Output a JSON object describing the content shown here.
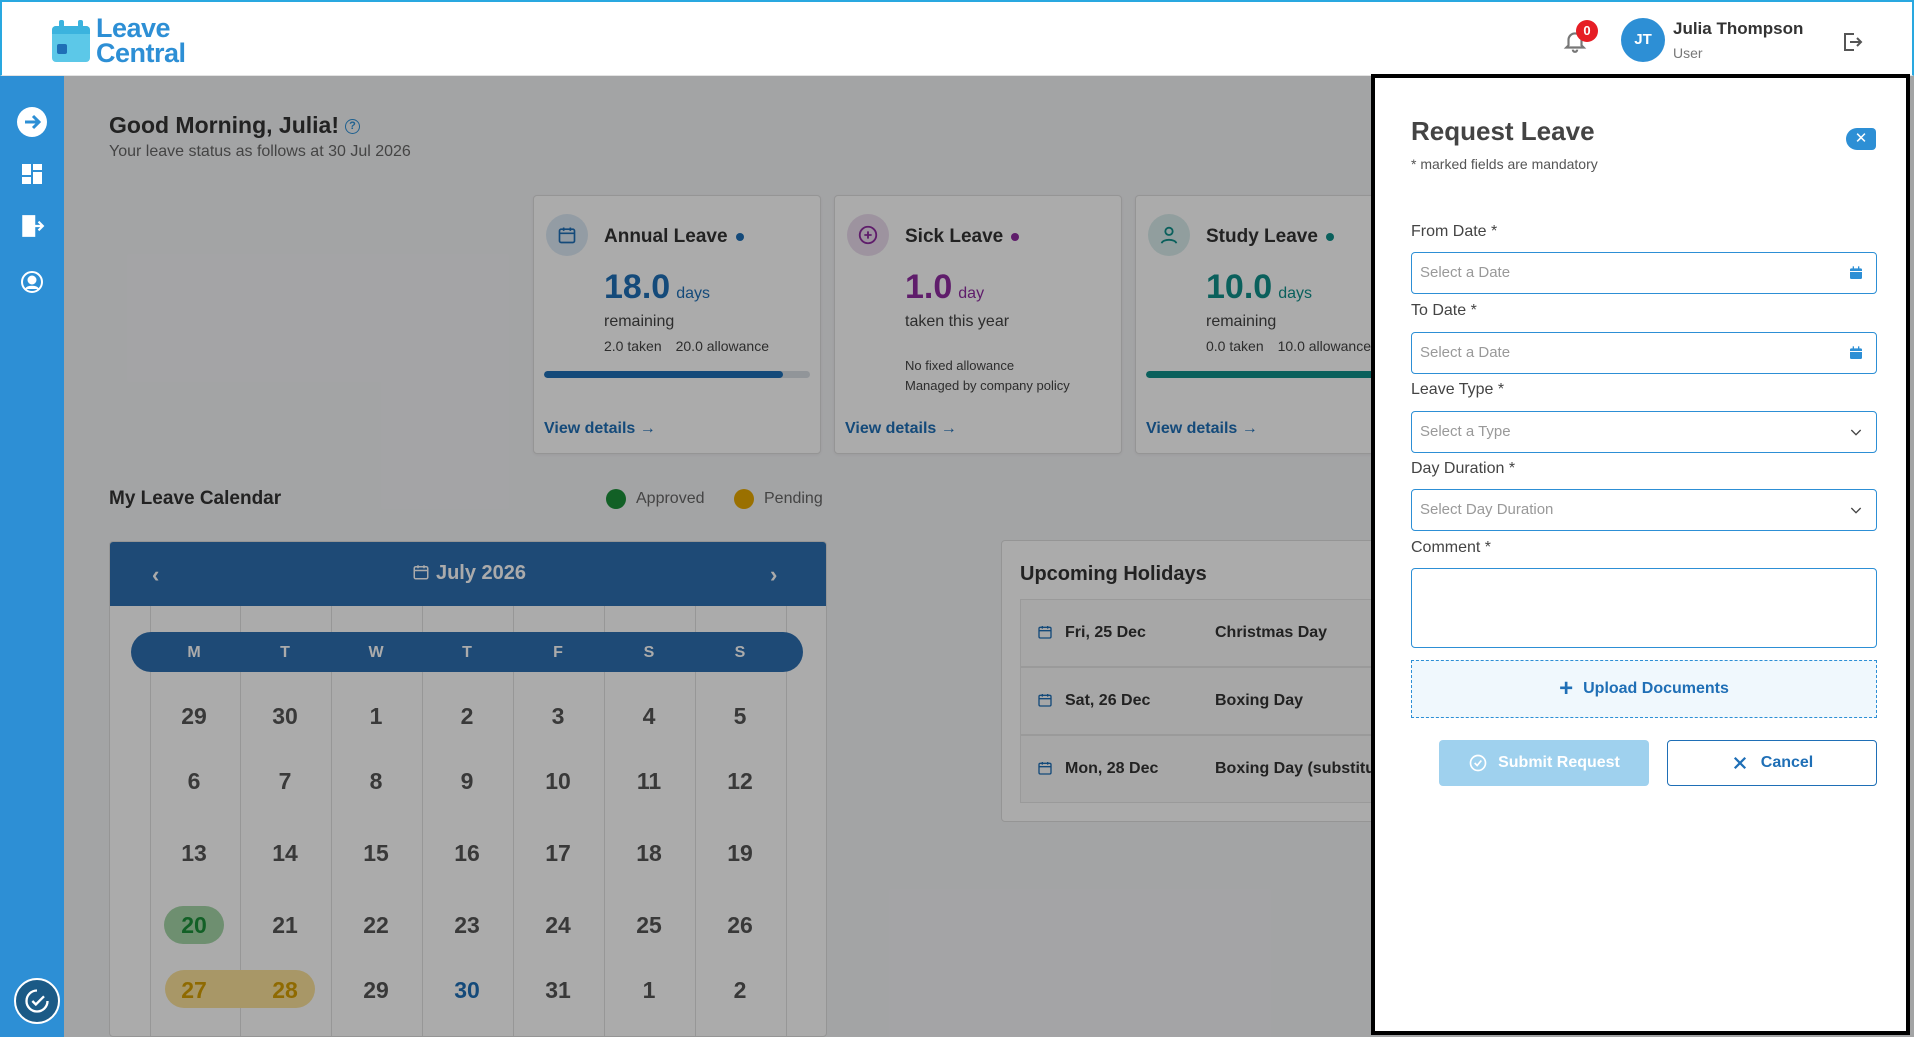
{
  "app": {
    "logo_line1": "Leave",
    "logo_line2": "Central"
  },
  "header": {
    "notification_count": "0",
    "avatar_initials": "JT",
    "user_name": "Julia Thompson",
    "user_role": "User"
  },
  "dashboard": {
    "greeting": "Good Morning, Julia!",
    "subtitle": "Your leave status as follows at 30 Jul 2026",
    "cards": [
      {
        "title": "Annual Leave",
        "value": "18.0",
        "unit": "days",
        "label": "remaining",
        "taken": "2.0 taken",
        "allowance": "20.0 allowance",
        "progress_percent": 90,
        "link": "View details",
        "accent": "#1f6fb6"
      },
      {
        "title": "Sick Leave",
        "value": "1.0",
        "unit": "day",
        "label": "taken this year",
        "note1": "No fixed allowance",
        "note2": "Managed by company policy",
        "link": "View details",
        "accent": "#8e2ca0"
      },
      {
        "title": "Study Leave",
        "value": "10.0",
        "unit": "days",
        "label": "remaining",
        "taken": "0.0 taken",
        "allowance": "10.0 allowance",
        "progress_percent": 100,
        "link": "View details",
        "accent": "#0f8f8a"
      }
    ],
    "calendar_title": "My Leave Calendar",
    "legend": {
      "approved": "Approved",
      "pending": "Pending",
      "approved_color": "#1b8f3a",
      "pending_color": "#e6a800"
    },
    "calendar": {
      "month": "July 2026",
      "weekdays": [
        "M",
        "T",
        "W",
        "T",
        "F",
        "S",
        "S"
      ],
      "weeks": [
        [
          "29",
          "30",
          "1",
          "2",
          "3",
          "4",
          "5"
        ],
        [
          "6",
          "7",
          "8",
          "9",
          "10",
          "11",
          "12"
        ],
        [
          "13",
          "14",
          "15",
          "16",
          "17",
          "18",
          "19"
        ],
        [
          "20",
          "21",
          "22",
          "23",
          "24",
          "25",
          "26"
        ],
        [
          "27",
          "28",
          "29",
          "30",
          "31",
          "1",
          "2"
        ]
      ]
    },
    "holidays": {
      "title": "Upcoming Holidays",
      "items": [
        {
          "date": "Fri, 25 Dec",
          "name": "Christmas Day"
        },
        {
          "date": "Sat, 26 Dec",
          "name": "Boxing Day"
        },
        {
          "date": "Mon, 28 Dec",
          "name": "Boxing Day (substitu"
        }
      ]
    }
  },
  "drawer": {
    "title": "Request Leave",
    "subtitle": "* marked fields are mandatory",
    "close_label": "✕",
    "from_label": "From Date *",
    "from_placeholder": "Select a Date",
    "to_label": "To Date *",
    "to_placeholder": "Select a Date",
    "type_label": "Leave Type *",
    "type_placeholder": "Select a Type",
    "duration_label": "Day Duration *",
    "duration_placeholder": "Select Day Duration",
    "comment_label": "Comment *",
    "upload_label": "Upload Documents",
    "submit_label": "Submit Request",
    "cancel_label": "Cancel"
  }
}
